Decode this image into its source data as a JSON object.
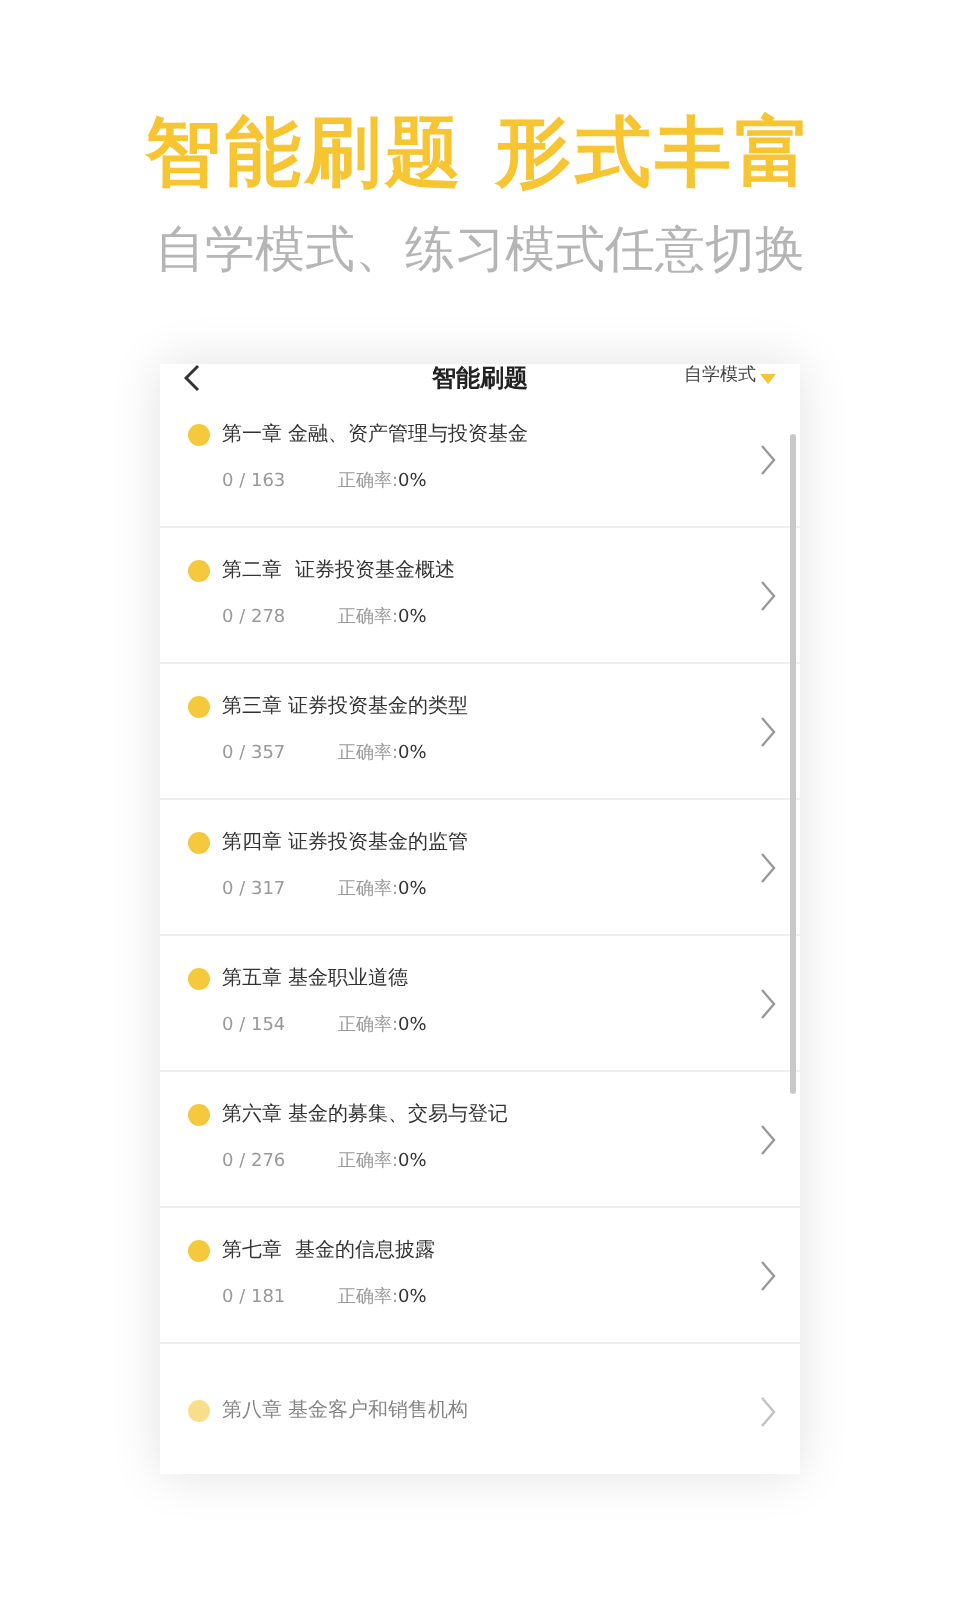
{
  "headline": "智能刷题 形式丰富",
  "subheadline": "自学模式、练习模式任意切换",
  "screen": {
    "title": "智能刷题",
    "mode_menu": "自学模式",
    "chapters": [
      {
        "title": "第一章 金融、资产管理与投资基金",
        "progress": "0 / 163",
        "accuracy_label": "正确率:",
        "accuracy": "0%"
      },
      {
        "title": "第二章  证券投资基金概述",
        "progress": "0 / 278",
        "accuracy_label": "正确率:",
        "accuracy": "0%"
      },
      {
        "title": "第三章 证券投资基金的类型",
        "progress": "0 / 357",
        "accuracy_label": "正确率:",
        "accuracy": "0%"
      },
      {
        "title": "第四章 证券投资基金的监管",
        "progress": "0 / 317",
        "accuracy_label": "正确率:",
        "accuracy": "0%"
      },
      {
        "title": "第五章 基金职业道德",
        "progress": "0 / 154",
        "accuracy_label": "正确率:",
        "accuracy": "0%"
      },
      {
        "title": "第六章 基金的募集、交易与登记",
        "progress": "0 / 276",
        "accuracy_label": "正确率:",
        "accuracy": "0%"
      },
      {
        "title": "第七章  基金的信息披露",
        "progress": "0 / 181",
        "accuracy_label": "正确率:",
        "accuracy": "0%"
      },
      {
        "title": "第八章 基金客户和销售机构"
      }
    ]
  }
}
